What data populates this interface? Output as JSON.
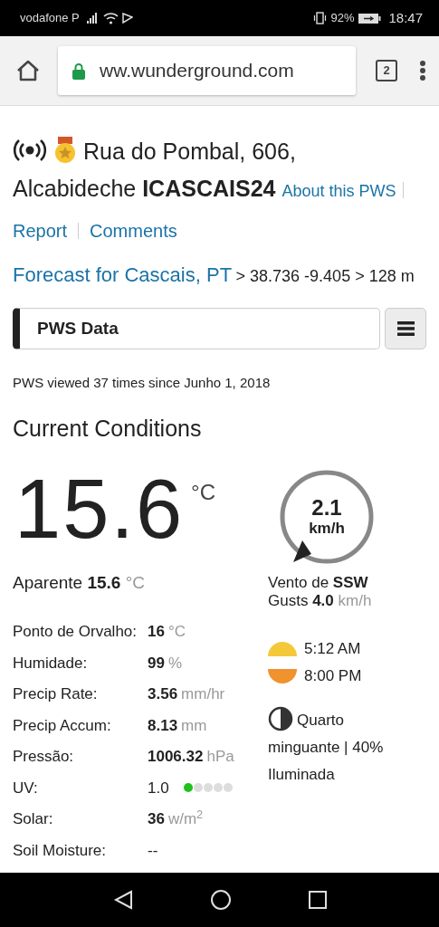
{
  "status_bar": {
    "carrier": "vodafone P",
    "battery": "92%",
    "time": "18:47"
  },
  "browser": {
    "url": "ww.wunderground.com",
    "tab_count": "2"
  },
  "station": {
    "address_lines": [
      "Rua do Pombal, 606,",
      "Alcabideche"
    ],
    "station_id": "ICASCAIS24",
    "about_link": "About this PWS",
    "links": [
      "Report",
      "Comments"
    ]
  },
  "forecast": {
    "link": "Forecast for Cascais, PT",
    "location_path": "> 38.736 -9.405 > 128 m"
  },
  "section_select": {
    "value": "PWS Data"
  },
  "views": "PWS viewed 37 times since Junho 1, 2018",
  "current": {
    "title": "Current Conditions",
    "temperature": "15.6",
    "unit": "°C",
    "feels_label": "Aparente",
    "feels_value": "15.6",
    "feels_unit": "°C",
    "rows": [
      {
        "kind": "plain",
        "label": "Ponto de Orvalho:",
        "value": "16",
        "unit": "°C",
        "emphasized": true
      },
      {
        "kind": "plain",
        "label": "Humidade:",
        "value": "99",
        "unit": "%",
        "emphasized": true
      },
      {
        "kind": "plain",
        "label": "Precip Rate:",
        "value": "3.56",
        "unit": "mm/hr",
        "emphasized": true
      },
      {
        "kind": "plain",
        "label": "Precip Accum:",
        "value": "8.13",
        "unit": "mm",
        "emphasized": true
      },
      {
        "kind": "plain",
        "label": "Pressão:",
        "value": "1006.32",
        "unit": "hPa",
        "emphasized": true
      },
      {
        "kind": "meter",
        "label": "UV:",
        "value": "1.0",
        "emphasized": false,
        "level": 0.2
      },
      {
        "kind": "plain",
        "label": "Solar:",
        "value": "36",
        "unit": "w/m$^{2}$",
        "emphasized": true
      },
      {
        "kind": "plain",
        "label": "Soil Moisture:",
        "value": "--",
        "emphasized": false
      }
    ]
  },
  "wind": {
    "speed": "2.1",
    "unit": "km/h",
    "direction_label": "Vento de",
    "direction": "SSW",
    "gusts_label": "Gusts",
    "gusts": "4.0",
    "gusts_unit": "km/h"
  },
  "sun": {
    "sunrise": "5:12 AM",
    "sunset": "8:00 PM"
  },
  "moon": {
    "phase_lines": [
      "Quarto",
      "minguante | 40%",
      "Iluminada"
    ]
  }
}
